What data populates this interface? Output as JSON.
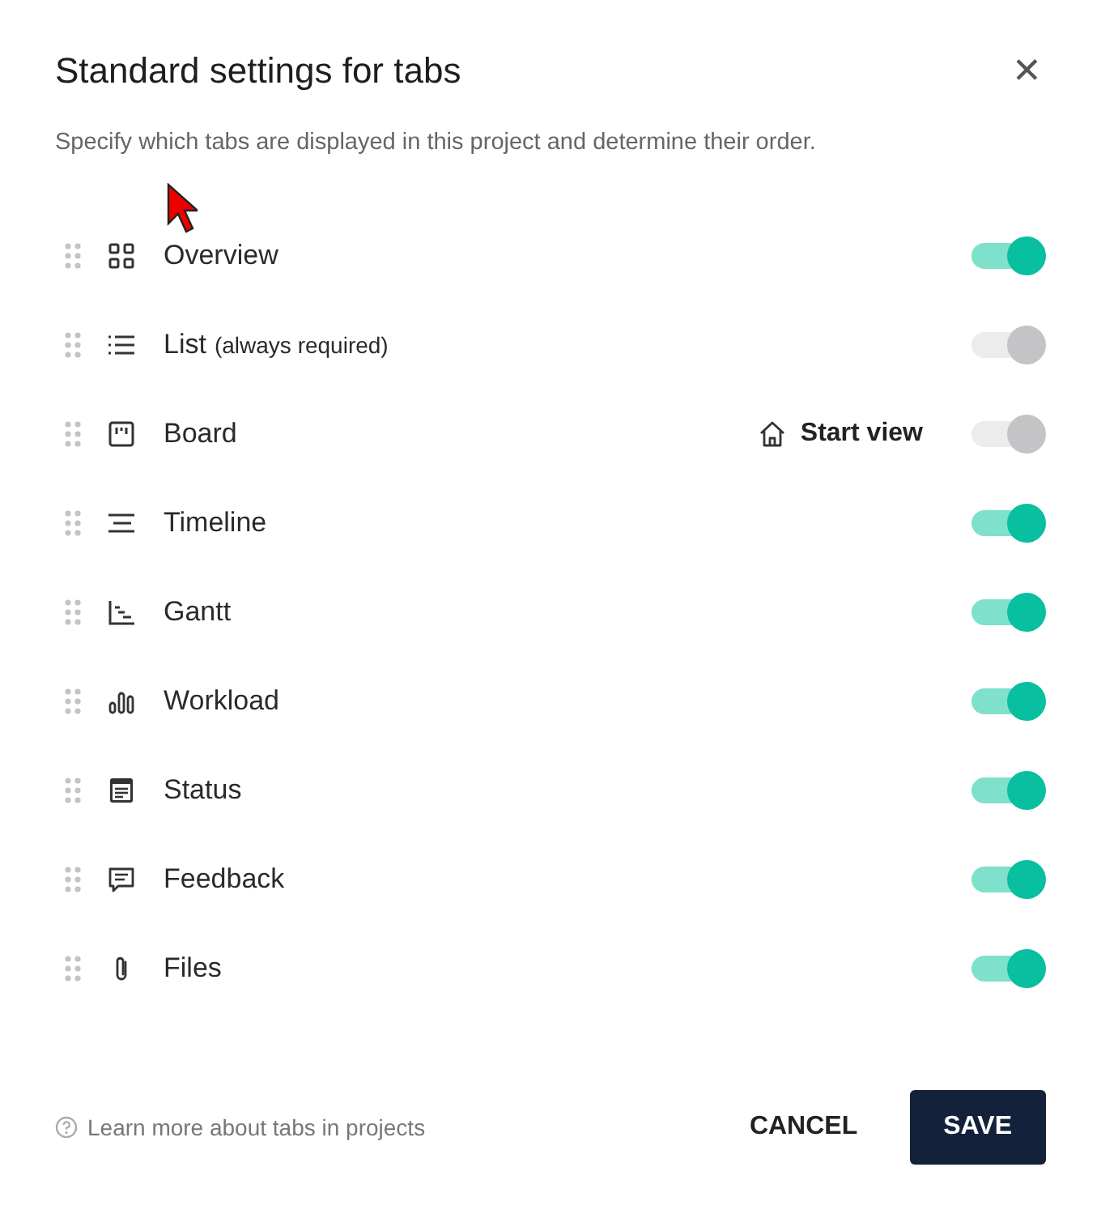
{
  "dialog": {
    "title": "Standard settings for tabs",
    "close_label": "✕",
    "description": "Specify which tabs are displayed in this project and determine their order."
  },
  "tabs": [
    {
      "kind": "overview",
      "label": "Overview",
      "on": true,
      "disabled": false
    },
    {
      "kind": "list",
      "label": "List",
      "note": "(always required)",
      "on": true,
      "disabled": true
    },
    {
      "kind": "board",
      "label": "Board",
      "start_view": "Start view",
      "on": true,
      "disabled": true
    },
    {
      "kind": "timeline",
      "label": "Timeline",
      "on": true,
      "disabled": false
    },
    {
      "kind": "gantt",
      "label": "Gantt",
      "on": true,
      "disabled": false
    },
    {
      "kind": "workload",
      "label": "Workload",
      "on": true,
      "disabled": false
    },
    {
      "kind": "status",
      "label": "Status",
      "on": true,
      "disabled": false
    },
    {
      "kind": "feedback",
      "label": "Feedback",
      "on": true,
      "disabled": false
    },
    {
      "kind": "files",
      "label": "Files",
      "on": true,
      "disabled": false
    }
  ],
  "footer": {
    "help_link": "Learn more about tabs in projects",
    "buttons": [
      {
        "kind": "secondary",
        "label": "CANCEL"
      },
      {
        "kind": "primary",
        "label": "SAVE"
      }
    ]
  }
}
